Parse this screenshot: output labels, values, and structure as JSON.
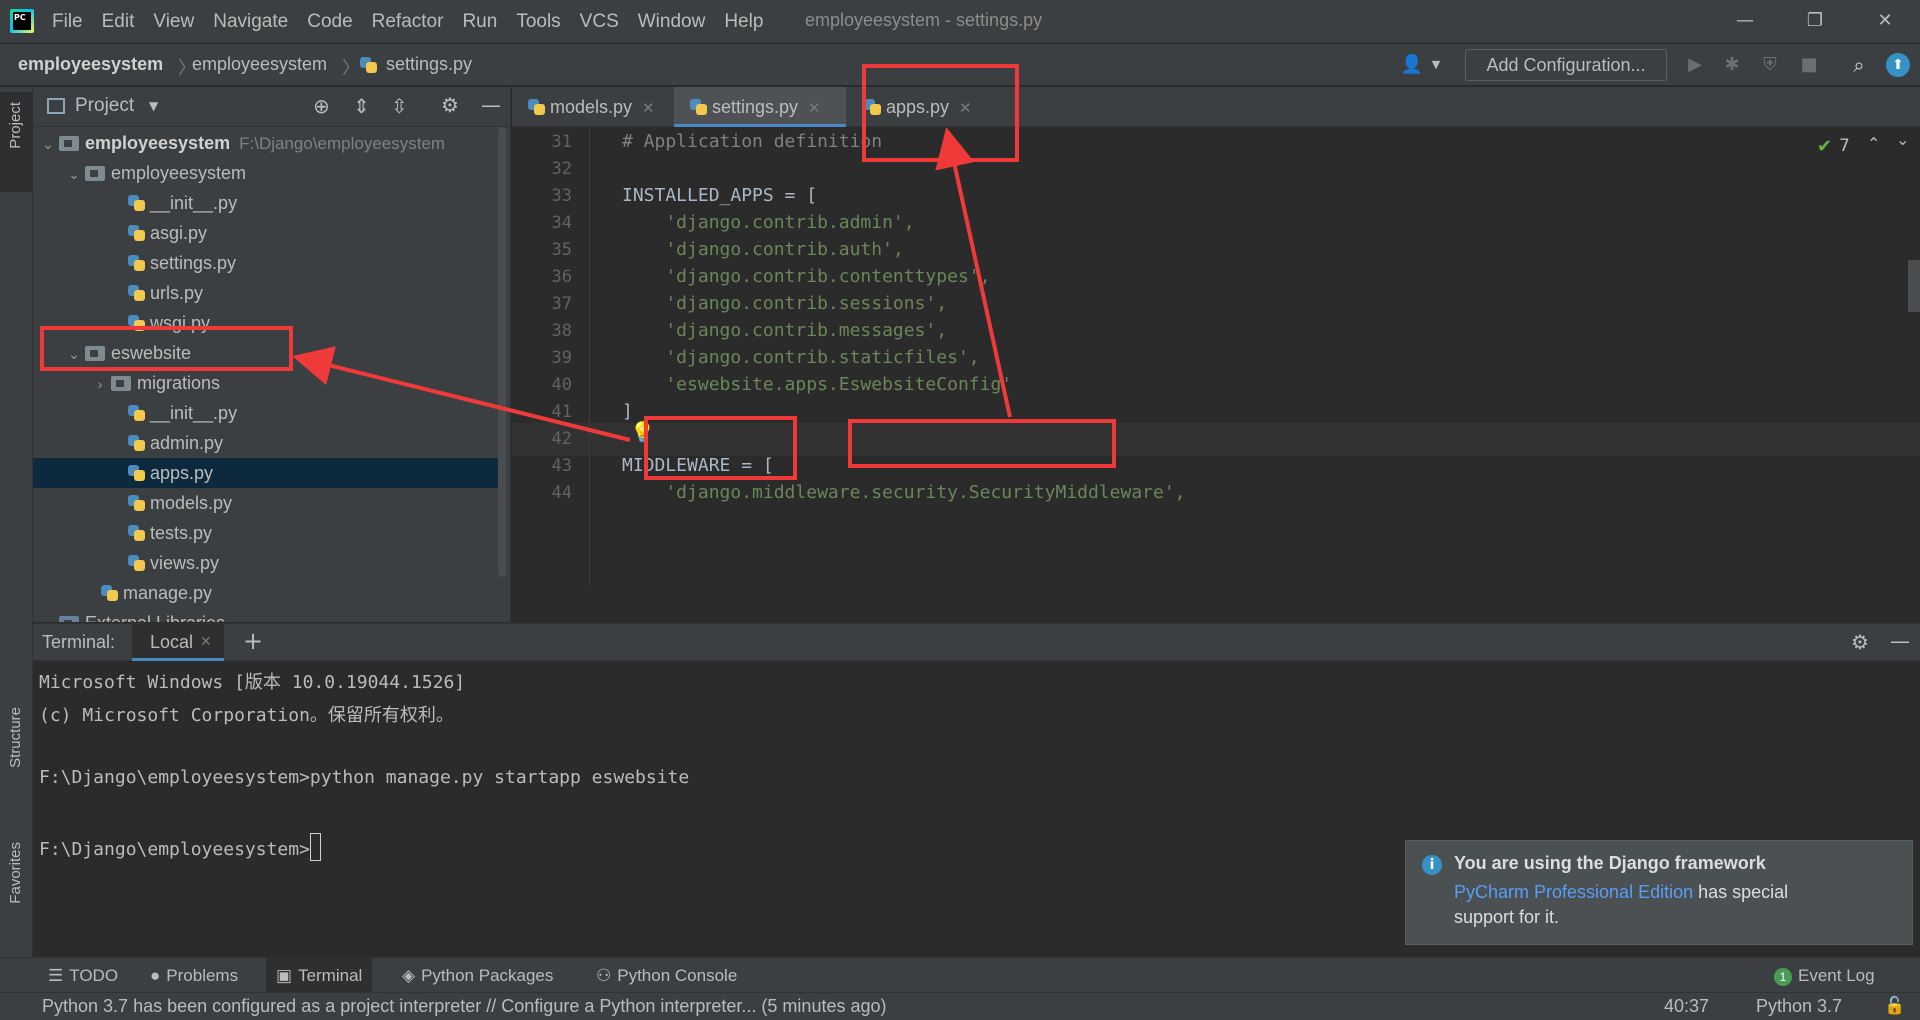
{
  "window": {
    "title": "employeesystem - settings.py",
    "controls": [
      "—",
      "❐",
      "✕"
    ]
  },
  "menu": [
    "File",
    "Edit",
    "View",
    "Navigate",
    "Code",
    "Refactor",
    "Run",
    "Tools",
    "VCS",
    "Window",
    "Help"
  ],
  "logo_text": "PC",
  "breadcrumb": [
    "employeesystem",
    "employeesystem",
    "settings.py"
  ],
  "toolbar": {
    "add_configuration": "Add Configuration..."
  },
  "sidebar": {
    "project_tab": "Project",
    "structure_tab": "Structure",
    "favorites_tab": "Favorites"
  },
  "project_panel": {
    "title": "Project",
    "root": {
      "name": "employeesystem",
      "path": "F:\\Django\\employeesystem"
    },
    "items": [
      {
        "label": "employeesystem",
        "kind": "folder"
      },
      {
        "label": "__init__.py",
        "kind": "py"
      },
      {
        "label": "asgi.py",
        "kind": "py"
      },
      {
        "label": "settings.py",
        "kind": "py"
      },
      {
        "label": "urls.py",
        "kind": "py"
      },
      {
        "label": "wsgi.py",
        "kind": "py"
      },
      {
        "label": "eswebsite",
        "kind": "folder"
      },
      {
        "label": "migrations",
        "kind": "folder"
      },
      {
        "label": "__init__.py",
        "kind": "py"
      },
      {
        "label": "admin.py",
        "kind": "py"
      },
      {
        "label": "apps.py",
        "kind": "py",
        "selected": true
      },
      {
        "label": "models.py",
        "kind": "py"
      },
      {
        "label": "tests.py",
        "kind": "py"
      },
      {
        "label": "views.py",
        "kind": "py"
      },
      {
        "label": "manage.py",
        "kind": "py"
      },
      {
        "label": "External Libraries",
        "kind": "lib"
      }
    ]
  },
  "tabs": [
    {
      "label": "models.py"
    },
    {
      "label": "settings.py",
      "active": true
    },
    {
      "label": "apps.py"
    }
  ],
  "editor": {
    "inspection_count": "7",
    "lines": [
      {
        "n": "31",
        "text": "# Application definition",
        "type": "comment"
      },
      {
        "n": "32",
        "text": "",
        "type": "plain"
      },
      {
        "n": "33",
        "text": "INSTALLED_APPS = [",
        "type": "plain"
      },
      {
        "n": "34",
        "text": "    'django.contrib.admin',",
        "type": "string"
      },
      {
        "n": "35",
        "text": "    'django.contrib.auth',",
        "type": "string"
      },
      {
        "n": "36",
        "text": "    'django.contrib.contenttypes',",
        "type": "string"
      },
      {
        "n": "37",
        "text": "    'django.contrib.sessions',",
        "type": "string"
      },
      {
        "n": "38",
        "text": "    'django.contrib.messages',",
        "type": "string"
      },
      {
        "n": "39",
        "text": "    'django.contrib.staticfiles',",
        "type": "string"
      },
      {
        "n": "40",
        "text": "    'eswebsite.apps.EswebsiteConfig'",
        "type": "string"
      },
      {
        "n": "41",
        "text": "]",
        "type": "plain"
      },
      {
        "n": "42",
        "text": "",
        "type": "plain"
      },
      {
        "n": "43",
        "text": "MIDDLEWARE = [",
        "type": "plain"
      },
      {
        "n": "44",
        "text": "    'django.middleware.security.SecurityMiddleware',",
        "type": "string"
      }
    ]
  },
  "terminal": {
    "label": "Terminal:",
    "tab": "Local",
    "lines": [
      "Microsoft Windows [版本 10.0.19044.1526]",
      "(c) Microsoft Corporation。保留所有权利。",
      "",
      "F:\\Django\\employeesystem>python manage.py startapp eswebsite",
      "",
      "F:\\Django\\employeesystem>"
    ]
  },
  "notification": {
    "title": "You are using the Django framework",
    "link": "PyCharm Professional Edition",
    "body_rest": " has special",
    "body_line2": "support for it."
  },
  "bottom_tools": [
    "TODO",
    "Problems",
    "Terminal",
    "Python Packages",
    "Python Console"
  ],
  "event_log": {
    "label": "Event Log",
    "count": "1"
  },
  "status": {
    "message": "Python 3.7 has been configured as a project interpreter // Configure a Python interpreter... (5 minutes ago)",
    "position": "40:37",
    "interpreter": "Python 3.7"
  },
  "colors": {
    "annotation": "#f03a3a",
    "accent": "#4a88c7",
    "link": "#589df6"
  }
}
